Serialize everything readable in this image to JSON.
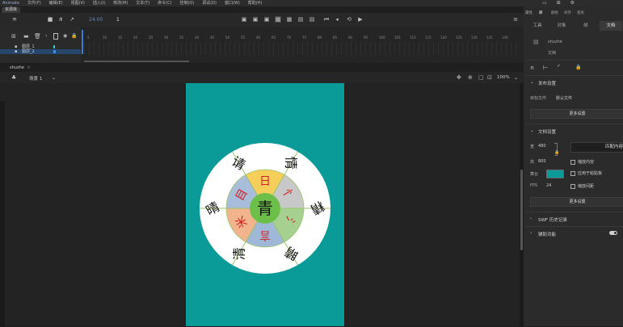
{
  "app": {
    "name": "Animate",
    "menu": [
      "文件(F)",
      "编辑(E)",
      "视图(V)",
      "插入(I)",
      "修改(M)",
      "文本(T)",
      "命令(C)",
      "控制(O)",
      "调试(D)",
      "窗口(W)",
      "帮助(H)"
    ]
  },
  "doc_tab": "资源库",
  "timeline": {
    "fps_display": "24.00",
    "frame_display": "1",
    "layers": [
      {
        "name": "图层_2"
      },
      {
        "name": "图层_1"
      }
    ],
    "ruler": [
      "5",
      "10",
      "15",
      "20",
      "25",
      "30",
      "35",
      "40",
      "45",
      "50",
      "55",
      "60",
      "65",
      "70",
      "75",
      "80",
      "85",
      "90",
      "95",
      "100",
      "105",
      "110",
      "115",
      "120",
      "125",
      "130",
      "135",
      "140"
    ]
  },
  "breadcrumb": "shuzhe",
  "scene": {
    "name": "场景 1",
    "zoom": "100%"
  },
  "wheel": {
    "center": "青",
    "outer": [
      "晴",
      "请",
      "情",
      "精",
      "睛",
      "清"
    ],
    "inner": [
      "日",
      "忄",
      "氵",
      "言",
      "米",
      "目"
    ],
    "colors": {
      "yellow": "#f6cf5a",
      "gray": "#c8c8c8",
      "green": "#a5d08f",
      "blue": "#9fb8d8",
      "orange": "#f2b48d",
      "slate": "#a7bdd9",
      "center": "#6cc04a"
    }
  },
  "right_panel": {
    "top_tabs": [
      "属性",
      "库",
      "颜色",
      "对齐",
      "变形"
    ],
    "sub_tabs": [
      "工具",
      "对象",
      "帧",
      "文档"
    ],
    "doc_name": "shuzhe",
    "doc_label": "文档",
    "publish": {
      "title": "发布设置",
      "target_label": "目标文件",
      "target_value": "默认文件",
      "more": "更多设置"
    },
    "doc_settings": {
      "title": "文档设置",
      "w_label": "宽",
      "w_value": "480",
      "h_label": "高",
      "h_value": "800",
      "match": "匹配内容",
      "scale_content": "缩放内容",
      "apply_to_pasteboard": "应用于粘贴板",
      "bg_label": "舞台",
      "fps_label": "FPS",
      "fps_value": "24",
      "scale_spacing": "缩放间距",
      "more": "更多设置"
    },
    "swf_history": "SWF 历史记录",
    "accessibility": "辅助功能",
    "stage_color": "#0a9a97"
  }
}
